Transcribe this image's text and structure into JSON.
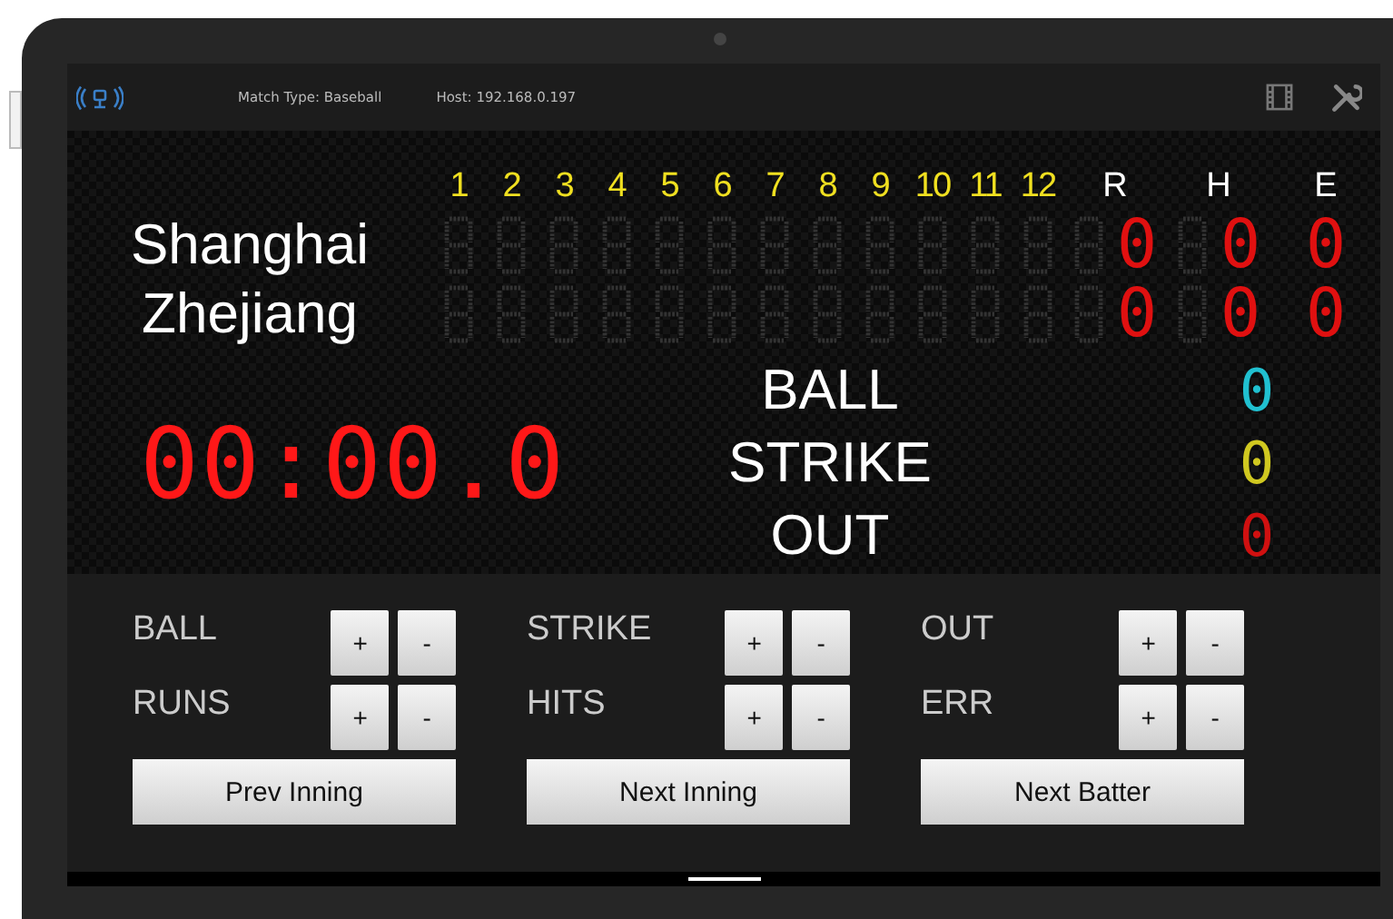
{
  "top_bar": {
    "match_type": "Match Type: Baseball",
    "host": "Host: 192.168.0.197"
  },
  "scoreboard": {
    "innings": [
      "1",
      "2",
      "3",
      "4",
      "5",
      "6",
      "7",
      "8",
      "9",
      "10",
      "11",
      "12"
    ],
    "totals": [
      "R",
      "H",
      "E"
    ],
    "teams": [
      {
        "name": "Shanghai",
        "runs": "0",
        "hits": "0",
        "errors": "0"
      },
      {
        "name": "Zhejiang",
        "runs": "0",
        "hits": "0",
        "errors": "0"
      }
    ],
    "timer": "00:00.0",
    "counts": [
      {
        "label": "BALL",
        "value": "0",
        "color": "#20c0d0"
      },
      {
        "label": "STRIKE",
        "value": "0",
        "color": "#d0c820"
      },
      {
        "label": "OUT",
        "value": "0",
        "color": "#d01010"
      }
    ]
  },
  "controls": {
    "rows": [
      [
        {
          "label": "BALL",
          "plus": "+",
          "minus": "-"
        },
        {
          "label": "STRIKE",
          "plus": "+",
          "minus": "-"
        },
        {
          "label": "OUT",
          "plus": "+",
          "minus": "-"
        }
      ],
      [
        {
          "label": "RUNS",
          "plus": "+",
          "minus": "-"
        },
        {
          "label": "HITS",
          "plus": "+",
          "minus": "-"
        },
        {
          "label": "ERR",
          "plus": "+",
          "minus": "-"
        }
      ]
    ],
    "buttons": [
      "Prev Inning",
      "Next Inning",
      "Next Batter"
    ]
  }
}
